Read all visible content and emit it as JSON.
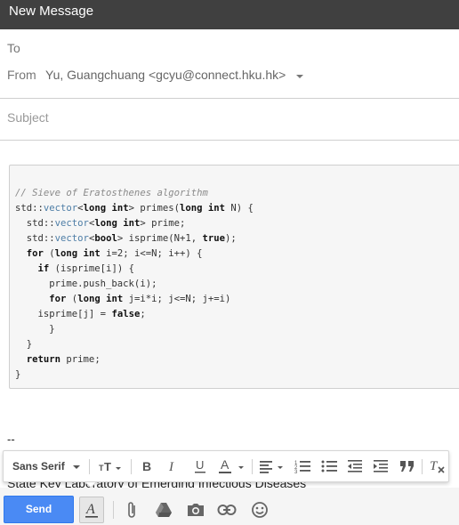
{
  "window": {
    "title": "New Message"
  },
  "recipients": {
    "to_label": "To",
    "from_label": "From",
    "from_value": "Yu, Guangchuang <gcyu@connect.hku.hk>"
  },
  "subject": {
    "placeholder": "Subject"
  },
  "body": {
    "code_lines": [
      [
        {
          "t": "// Sieve of Eratosthenes algorithm",
          "c": "com"
        }
      ],
      [
        {
          "t": "std::"
        },
        {
          "t": "vector",
          "c": "ty"
        },
        {
          "t": "<"
        },
        {
          "t": "long int",
          "c": "kw"
        },
        {
          "t": "> primes("
        },
        {
          "t": "long int",
          "c": "kw"
        },
        {
          "t": " N) {"
        }
      ],
      [
        {
          "t": "  std::"
        },
        {
          "t": "vector",
          "c": "ty"
        },
        {
          "t": "<"
        },
        {
          "t": "long int",
          "c": "kw"
        },
        {
          "t": "> prime;"
        }
      ],
      [
        {
          "t": "  std::"
        },
        {
          "t": "vector",
          "c": "ty"
        },
        {
          "t": "<"
        },
        {
          "t": "bool",
          "c": "kw"
        },
        {
          "t": "> isprime(N+1, "
        },
        {
          "t": "true",
          "c": "kw"
        },
        {
          "t": ");"
        }
      ],
      [
        {
          "t": "  "
        },
        {
          "t": "for",
          "c": "kw"
        },
        {
          "t": " ("
        },
        {
          "t": "long int",
          "c": "kw"
        },
        {
          "t": " i=2; i<=N; i++) {"
        }
      ],
      [
        {
          "t": "    "
        },
        {
          "t": "if",
          "c": "kw"
        },
        {
          "t": " (isprime[i]) {"
        }
      ],
      [
        {
          "t": "      prime.push_back(i);"
        }
      ],
      [
        {
          "t": "      "
        },
        {
          "t": "for",
          "c": "kw"
        },
        {
          "t": " ("
        },
        {
          "t": "long int",
          "c": "kw"
        },
        {
          "t": " j=i*i; j<=N; j+=i)"
        }
      ],
      [
        {
          "t": "    isprime[j] = "
        },
        {
          "t": "false",
          "c": "kw"
        },
        {
          "t": ";"
        }
      ],
      [
        {
          "t": "      }"
        }
      ],
      [
        {
          "t": "  }"
        }
      ],
      [
        {
          "t": "  "
        },
        {
          "t": "return",
          "c": "kw"
        },
        {
          "t": " prime;"
        }
      ],
      [
        {
          "t": "}"
        }
      ]
    ],
    "signature_dash": "--",
    "signature_partial": "State Key Laboratory of Emerging Infectious Diseases"
  },
  "format_toolbar": {
    "font": "Sans Serif",
    "icons": [
      "font-size-icon",
      "bold-icon",
      "italic-icon",
      "underline-icon",
      "text-color-icon",
      "align-icon",
      "numbered-list-icon",
      "bulleted-list-icon",
      "indent-less-icon",
      "indent-more-icon",
      "quote-icon",
      "remove-formatting-icon"
    ]
  },
  "bottom_bar": {
    "send_label": "Send",
    "icons": [
      "formatting-options-icon",
      "attach-icon",
      "drive-icon",
      "photo-icon",
      "link-icon",
      "emoji-icon"
    ]
  },
  "colors": {
    "titlebar": "#404040",
    "send_button": "#4a8af4",
    "code_type": "#4d7da6",
    "code_comment": "#8a8a8a"
  }
}
